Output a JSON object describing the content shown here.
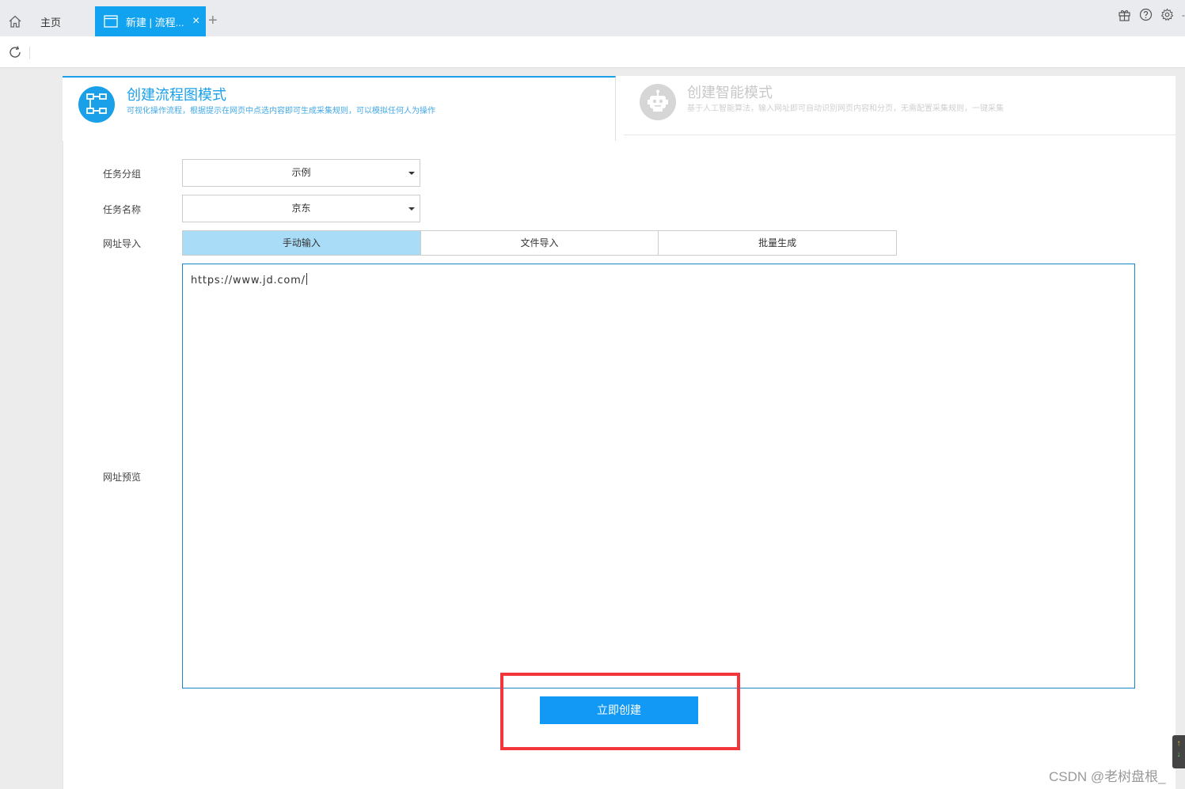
{
  "tabs": {
    "home_label": "主页",
    "active_label": "新建 | 流程...",
    "close_glyph": "×",
    "add_glyph": "+"
  },
  "top_icons": [
    "gift-icon",
    "help-icon",
    "settings-icon"
  ],
  "top_dash": "-",
  "modes": {
    "flowchart": {
      "title": "创建流程图模式",
      "desc": "可视化操作流程，根据提示在网页中点选内容即可生成采集规则，可以模拟任何人为操作"
    },
    "smart": {
      "title": "创建智能模式",
      "desc": "基于人工智能算法，输入网址即可自动识别网页内容和分页，无需配置采集规则，一键采集"
    }
  },
  "form": {
    "group_label": "任务分组",
    "group_value": "示例",
    "name_label": "任务名称",
    "name_value": "京东",
    "import_label": "网址导入",
    "import_options": [
      "手动输入",
      "文件导入",
      "批量生成"
    ],
    "import_selected": "手动输入",
    "preview_label": "网址预览",
    "url_text": "https://www.jd.com/"
  },
  "create_button": "立即创建",
  "scroll_widget": {
    "up": "↑",
    "down": "↓"
  },
  "watermark": "CSDN @老树盘根_",
  "colors": {
    "accent": "#12a3f0",
    "button": "#1199f5",
    "highlight": "#f2363b",
    "segment_active": "#a9dcf7"
  }
}
